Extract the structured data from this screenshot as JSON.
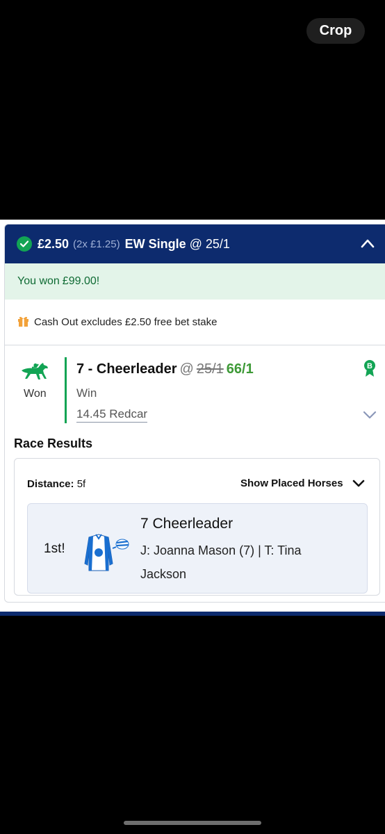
{
  "toolbar": {
    "crop_label": "Crop"
  },
  "bet": {
    "stake": "£2.50",
    "split": "(2x £1.25)",
    "type": "EW Single",
    "odds": "@ 25/1",
    "won_text": "You won",
    "won_amount": "£99.00",
    "won_suffix": "!",
    "cashout_note": "Cash Out excludes £2.50 free bet stake"
  },
  "selection": {
    "status": "Won",
    "name": "7 - Cheerleader",
    "at": "@",
    "old_odds": "25/1",
    "new_odds": "66/1",
    "market": "Win",
    "event": "14.45 Redcar",
    "badge": "B"
  },
  "race_results": {
    "title": "Race Results",
    "distance_label": "Distance:",
    "distance_value": "5f",
    "show_placed_label": "Show Placed Horses",
    "runner": {
      "position": "1st!",
      "name": "7 Cheerleader",
      "details": "J: Joanna Mason (7) | T: Tina Jackson"
    }
  },
  "colors": {
    "header_bg": "#0d2b6e",
    "won_bg": "#e3f4e9",
    "win_green": "#12a454",
    "new_odds": "#3e9a37"
  }
}
